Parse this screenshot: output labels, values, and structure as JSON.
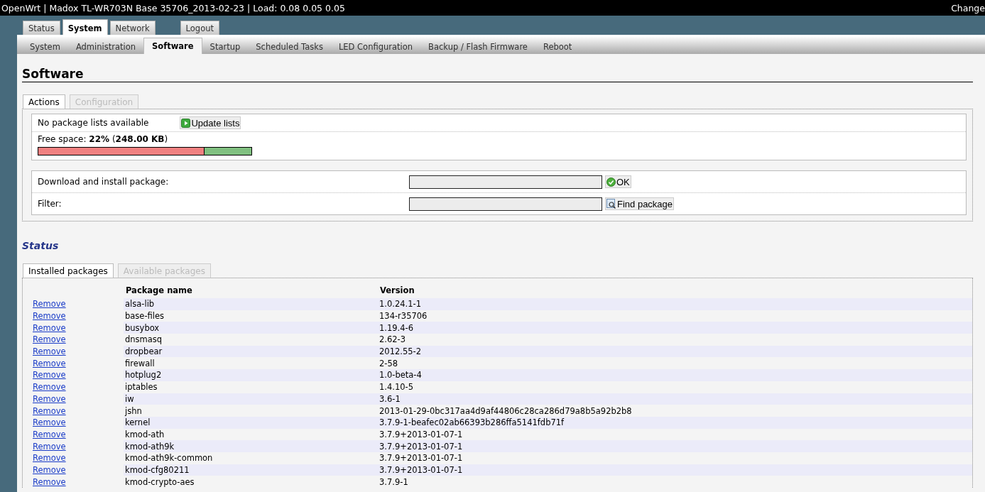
{
  "header": {
    "title": "OpenWrt | Madox TL-WR703N Base 35706_2013-02-23 | Load: 0.08 0.05 0.05",
    "changes": "Change"
  },
  "main_tabs": [
    {
      "label": "Status",
      "selected": false
    },
    {
      "label": "System",
      "selected": true
    },
    {
      "label": "Network",
      "selected": false
    }
  ],
  "logout": "Logout",
  "sub_tabs": [
    {
      "label": "System",
      "selected": false
    },
    {
      "label": "Administration",
      "selected": false
    },
    {
      "label": "Software",
      "selected": true
    },
    {
      "label": "Startup",
      "selected": false
    },
    {
      "label": "Scheduled Tasks",
      "selected": false
    },
    {
      "label": "LED Configuration",
      "selected": false
    },
    {
      "label": "Backup / Flash Firmware",
      "selected": false
    },
    {
      "label": "Reboot",
      "selected": false
    }
  ],
  "page_title": "Software",
  "action_tabs": [
    {
      "label": "Actions",
      "selected": true
    },
    {
      "label": "Configuration",
      "selected": false
    }
  ],
  "lists_status": "No package lists available",
  "update_button": "Update lists",
  "free_space": {
    "text": "Free space: **22%** (**248.00 KB**)",
    "level": 0.22
  },
  "install": {
    "label": "Download and install package:",
    "button": "OK"
  },
  "filter": {
    "label": "Filter:",
    "button": "Find package"
  },
  "status_title": "Status",
  "package_tabs": [
    {
      "label": "Installed packages",
      "selected": true
    },
    {
      "label": "Available packages",
      "selected": false
    }
  ],
  "table": {
    "columns": [
      "Package name",
      "Version"
    ],
    "rows": [
      {
        "action": "Remove",
        "name": "alsa-lib",
        "version": "1.0.24.1-1"
      },
      {
        "action": "Remove",
        "name": "base-files",
        "version": "134-r35706"
      },
      {
        "action": "Remove",
        "name": "busybox",
        "version": "1.19.4-6"
      },
      {
        "action": "Remove",
        "name": "dnsmasq",
        "version": "2.62-3"
      },
      {
        "action": "Remove",
        "name": "dropbear",
        "version": "2012.55-2"
      },
      {
        "action": "Remove",
        "name": "firewall",
        "version": "2-58"
      },
      {
        "action": "Remove",
        "name": "hotplug2",
        "version": "1.0-beta-4"
      },
      {
        "action": "Remove",
        "name": "iptables",
        "version": "1.4.10-5"
      },
      {
        "action": "Remove",
        "name": "iw",
        "version": "3.6-1"
      },
      {
        "action": "Remove",
        "name": "jshn",
        "version": "2013-01-29-0bc317aa4d9af44806c28ca286d79a8b5a92b2b8"
      },
      {
        "action": "Remove",
        "name": "kernel",
        "version": "3.7.9-1-beafec02ab66393b286ffa5141fdb71f"
      },
      {
        "action": "Remove",
        "name": "kmod-ath",
        "version": "3.7.9+2013-01-07-1"
      },
      {
        "action": "Remove",
        "name": "kmod-ath9k",
        "version": "3.7.9+2013-01-07-1"
      },
      {
        "action": "Remove",
        "name": "kmod-ath9k-common",
        "version": "3.7.9+2013-01-07-1"
      },
      {
        "action": "Remove",
        "name": "kmod-cfg80211",
        "version": "3.7.9+2013-01-07-1"
      },
      {
        "action": "Remove",
        "name": "kmod-crypto-aes",
        "version": "3.7.9-1"
      }
    ]
  }
}
